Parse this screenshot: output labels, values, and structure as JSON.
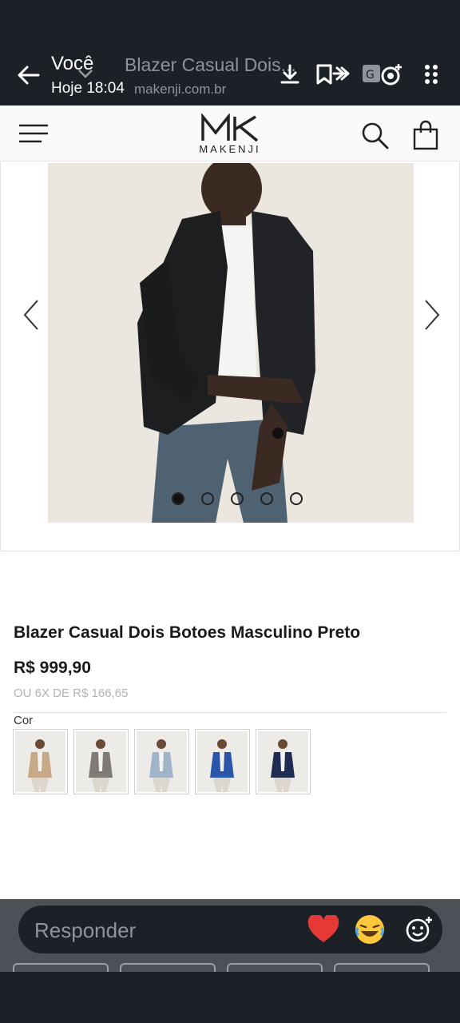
{
  "viewer": {
    "sender": "Você",
    "time": "Hoje 18:04",
    "page_title": "Blazer Casual Dois...",
    "page_url": "makenji.com.br"
  },
  "site": {
    "brand": "MAKENJI"
  },
  "gallery": {
    "image_count": 5,
    "active_index": 0
  },
  "product": {
    "title": "Blazer Casual Dois Botoes Masculino Preto",
    "price": "R$ 999,90",
    "installments": "OU 6X DE R$ 166,65",
    "color_label": "Cor",
    "color_swatches": [
      {
        "name": "bege",
        "color": "#c8a987"
      },
      {
        "name": "cinza",
        "color": "#7f7a76"
      },
      {
        "name": "azul-claro",
        "color": "#9fb4c7"
      },
      {
        "name": "azul-royal",
        "color": "#2a55a8"
      },
      {
        "name": "marinho",
        "color": "#1f2d52"
      }
    ]
  },
  "reply_bar": {
    "placeholder": "Responder",
    "reactions": [
      "heart",
      "laughing-face"
    ]
  },
  "colors": {
    "overlay_dark": "#1c2128",
    "text_primary": "#1a1a1a",
    "text_muted": "#b3b3b3"
  }
}
